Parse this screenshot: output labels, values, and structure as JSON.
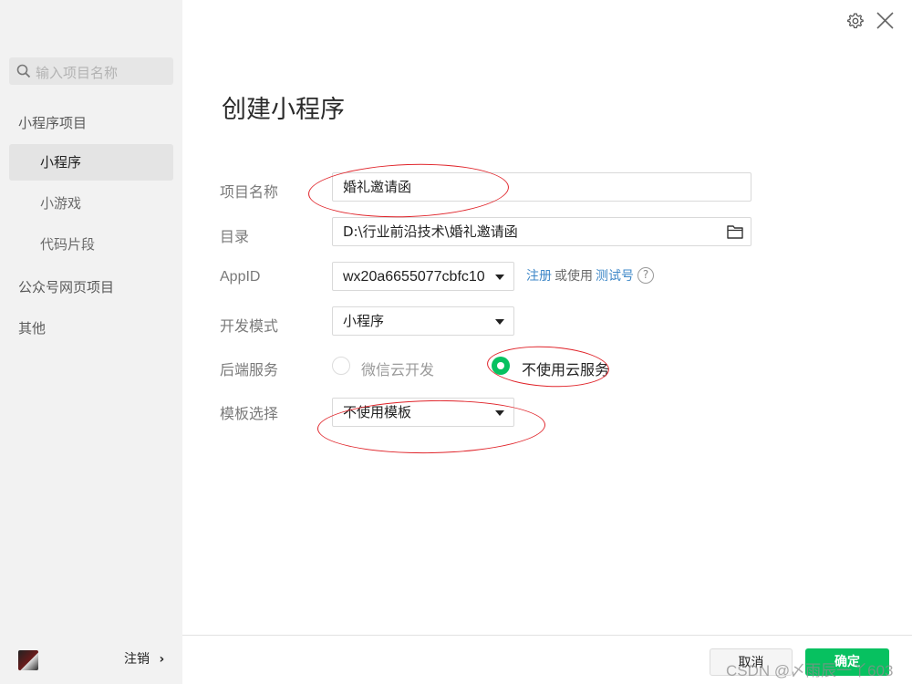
{
  "sidebar": {
    "search_placeholder": "输入项目名称",
    "category_mini": "小程序项目",
    "sub_items": [
      "小程序",
      "小游戏",
      "代码片段"
    ],
    "category_official": "公众号网页项目",
    "category_other": "其他",
    "logout_label": "注销",
    "logout_chevron": "›"
  },
  "header": {
    "title": "创建小程序",
    "settings_icon": "gear-icon",
    "close_icon": "close-icon"
  },
  "form": {
    "project_name": {
      "label": "项目名称",
      "value": "婚礼邀请函"
    },
    "directory": {
      "label": "目录",
      "value": "D:\\行业前沿技术\\婚礼邀请函",
      "icon": "folder-icon"
    },
    "appid": {
      "label": "AppID",
      "value": "wx20a6655077cbfc10",
      "register_link": "注册",
      "or_use": "或使用",
      "test_link": "测试号",
      "help": "?"
    },
    "dev_mode": {
      "label": "开发模式",
      "value": "小程序"
    },
    "backend": {
      "label": "后端服务",
      "option_cloud": "微信云开发",
      "option_none": "不使用云服务",
      "selected": "不使用云服务"
    },
    "template": {
      "label": "模板选择",
      "value": "不使用模板"
    }
  },
  "footer": {
    "cancel_label": "取消",
    "confirm_label": "确定"
  },
  "watermark": "CSDN @〆雨辰一丫603",
  "colors": {
    "accent_green": "#07c160",
    "link_blue": "#3f88c8",
    "annotation_red": "#e0242a",
    "sidebar_bg": "#f2f2f2"
  }
}
